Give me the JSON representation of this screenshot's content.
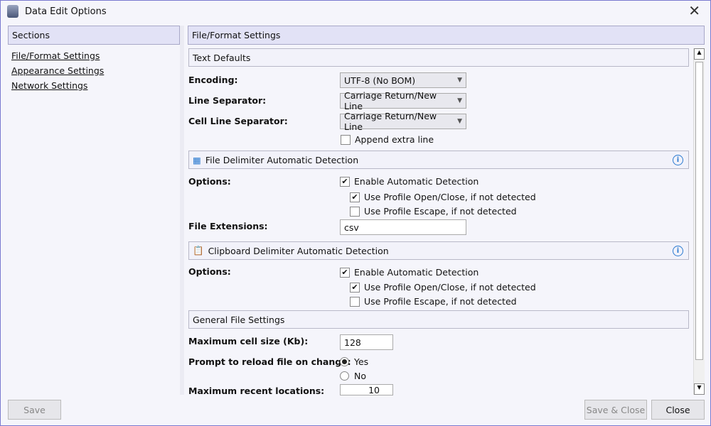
{
  "window": {
    "title": "Data Edit Options",
    "icon": "database-edit-icon"
  },
  "sidebar": {
    "header": "Sections",
    "items": [
      {
        "label": "File/Format Settings"
      },
      {
        "label": "Appearance Settings"
      },
      {
        "label": "Network Settings"
      }
    ]
  },
  "main": {
    "header": "File/Format Settings",
    "text_defaults": {
      "title": "Text Defaults",
      "encoding_label": "Encoding:",
      "encoding_value": "UTF-8 (No BOM)",
      "line_sep_label": "Line Separator:",
      "line_sep_value": "Carriage Return/New Line",
      "cell_line_sep_label": "Cell Line Separator:",
      "cell_line_sep_value": "Carriage Return/New Line",
      "append_extra_line": "Append extra line",
      "append_checked": false
    },
    "file_delim": {
      "title": "File Delimiter Automatic Detection",
      "options_label": "Options:",
      "enable": "Enable Automatic Detection",
      "enable_checked": true,
      "open_close": "Use Profile Open/Close, if not detected",
      "open_close_checked": true,
      "escape": "Use Profile Escape, if not detected",
      "escape_checked": false,
      "ext_label": "File Extensions:",
      "ext_value": "csv"
    },
    "clip_delim": {
      "title": "Clipboard Delimiter Automatic Detection",
      "options_label": "Options:",
      "enable": "Enable Automatic Detection",
      "enable_checked": true,
      "open_close": "Use Profile Open/Close, if not detected",
      "open_close_checked": true,
      "escape": "Use Profile Escape, if not detected",
      "escape_checked": false
    },
    "general": {
      "title": "General File Settings",
      "max_cell_label": "Maximum cell size (Kb):",
      "max_cell_value": "128",
      "prompt_label": "Prompt to reload file on change:",
      "yes": "Yes",
      "no": "No",
      "prompt_selected": "Yes",
      "recent_label": "Maximum recent locations:",
      "recent_value": "10"
    }
  },
  "footer": {
    "save": "Save",
    "save_close": "Save & Close",
    "close": "Close"
  }
}
